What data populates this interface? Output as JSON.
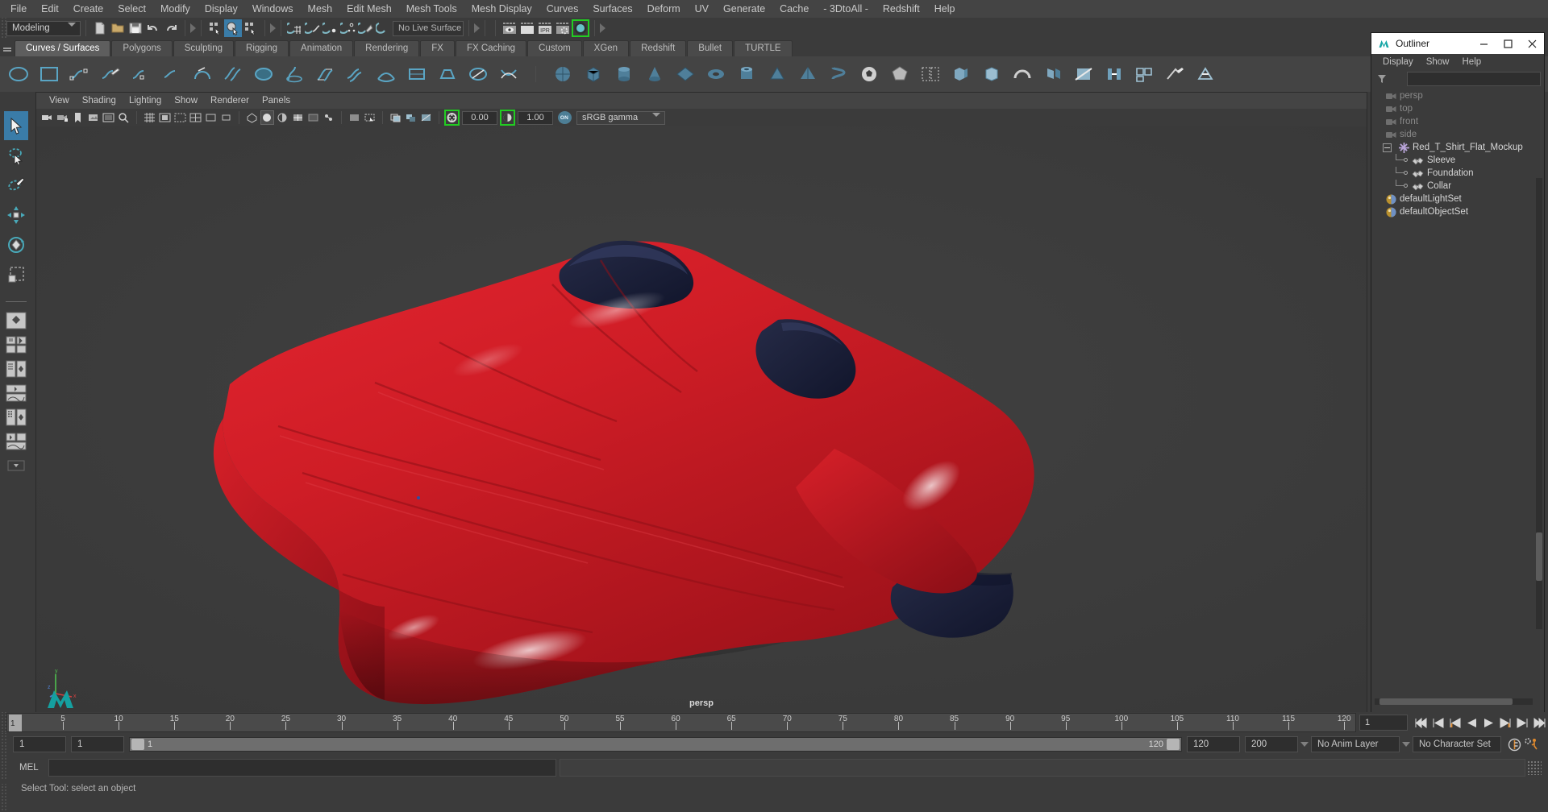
{
  "app": {
    "name": "Autodesk Maya"
  },
  "menubar": {
    "items": [
      "File",
      "Edit",
      "Create",
      "Select",
      "Modify",
      "Display",
      "Windows",
      "Mesh",
      "Edit Mesh",
      "Mesh Tools",
      "Mesh Display",
      "Curves",
      "Surfaces",
      "Deform",
      "UV",
      "Generate",
      "Cache",
      "- 3DtoAll -",
      "Redshift",
      "Help"
    ]
  },
  "statusline": {
    "menuset": "Modeling",
    "live_surface": "No Live Surface",
    "icons": [
      "new-scene-icon",
      "open-scene-icon",
      "save-scene-icon",
      "undo-icon",
      "redo-icon",
      "select-by-hierarchy-icon",
      "select-by-object-icon",
      "select-by-component-icon",
      "snap-to-grid-icon",
      "snap-to-curve-icon",
      "snap-to-point-icon",
      "snap-to-projected-center-icon",
      "snap-to-view-plane-icon",
      "make-live-icon",
      "render-view-icon",
      "render-current-frame-icon",
      "ipr-render-icon",
      "render-settings-icon",
      "hypershade-icon"
    ]
  },
  "shelf": {
    "tabs": [
      "Curves / Surfaces",
      "Polygons",
      "Sculpting",
      "Rigging",
      "Animation",
      "Rendering",
      "FX",
      "FX Caching",
      "Custom",
      "XGen",
      "Redshift",
      "Bullet",
      "TURTLE"
    ],
    "active_tab": "Curves / Surfaces"
  },
  "toolbox": {
    "tools": [
      "select-tool",
      "lasso-select-tool",
      "paint-select-tool",
      "move-tool",
      "rotate-tool",
      "scale-tool"
    ],
    "active_tool": "select-tool",
    "layouts": [
      "single-perspective-layout",
      "four-view-layout",
      "outliner-persp-layout",
      "persp-graph-layout",
      "hypershade-persp-layout",
      "persp-graph-outliner-layout"
    ]
  },
  "viewport": {
    "menus": [
      "View",
      "Shading",
      "Lighting",
      "Show",
      "Renderer",
      "Panels"
    ],
    "camera_label": "persp",
    "exposure": "0.00",
    "gamma": "1.00",
    "color_management": "sRGB gamma",
    "cm_toggle": "ON"
  },
  "outliner": {
    "title": "Outliner",
    "menus": [
      "Display",
      "Show",
      "Help"
    ],
    "search_placeholder": "",
    "items": [
      {
        "label": "persp",
        "icon": "camera-icon",
        "depth": 1,
        "dim": true,
        "expander": false
      },
      {
        "label": "top",
        "icon": "camera-icon",
        "depth": 1,
        "dim": true,
        "expander": false
      },
      {
        "label": "front",
        "icon": "camera-icon",
        "depth": 1,
        "dim": true,
        "expander": false
      },
      {
        "label": "side",
        "icon": "camera-icon",
        "depth": 1,
        "dim": true,
        "expander": false
      },
      {
        "label": "Red_T_Shirt_Flat_Mockup",
        "icon": "group-icon",
        "depth": 1,
        "dim": false,
        "expander": true
      },
      {
        "label": "Sleeve",
        "icon": "mesh-icon",
        "depth": 2,
        "dim": false,
        "expander": false
      },
      {
        "label": "Foundation",
        "icon": "mesh-icon",
        "depth": 2,
        "dim": false,
        "expander": false
      },
      {
        "label": "Collar",
        "icon": "mesh-icon",
        "depth": 2,
        "dim": false,
        "expander": false
      },
      {
        "label": "defaultLightSet",
        "icon": "set-icon",
        "depth": 1,
        "dim": false,
        "expander": false
      },
      {
        "label": "defaultObjectSet",
        "icon": "set-icon",
        "depth": 1,
        "dim": false,
        "expander": false
      }
    ],
    "window_buttons": {
      "minimize": "–",
      "maximize": "☐",
      "close": "✕"
    }
  },
  "timeline": {
    "current_frame": "1",
    "ticks": [
      5,
      10,
      15,
      20,
      25,
      30,
      35,
      40,
      45,
      50,
      55,
      60,
      65,
      70,
      75,
      80,
      85,
      90,
      95,
      100,
      105,
      110,
      115,
      120
    ],
    "range_start": 1,
    "range_end": 120,
    "end_box": "120",
    "frame_box": "1",
    "playback_buttons": [
      "go-to-start-icon",
      "step-back-keyframe-icon",
      "step-back-frame-icon",
      "play-backwards-icon",
      "play-forwards-icon",
      "step-forward-frame-icon",
      "step-forward-keyframe-icon",
      "go-to-end-icon"
    ]
  },
  "rangeslider": {
    "anim_start": "1",
    "range_start": "1",
    "bar_start_label": "1",
    "bar_end_label": "120",
    "range_end": "120",
    "anim_end": "200",
    "anim_layer": "No Anim Layer",
    "character_set": "No Character Set",
    "auto_key_icon": "auto-keyframe-icon",
    "prefs_icon": "animation-preferences-icon"
  },
  "command": {
    "language": "MEL",
    "input_value": "",
    "output_value": ""
  },
  "helpline": {
    "text": "Select Tool: select an object"
  },
  "colors": {
    "accent_blue": "#3a7ca8",
    "shelf_teal": "#5aa5b5",
    "green_outline": "#22cc22",
    "orange": "#e08a2e",
    "shirt_red": "#cc1b22",
    "collar_navy": "#1b2038"
  }
}
